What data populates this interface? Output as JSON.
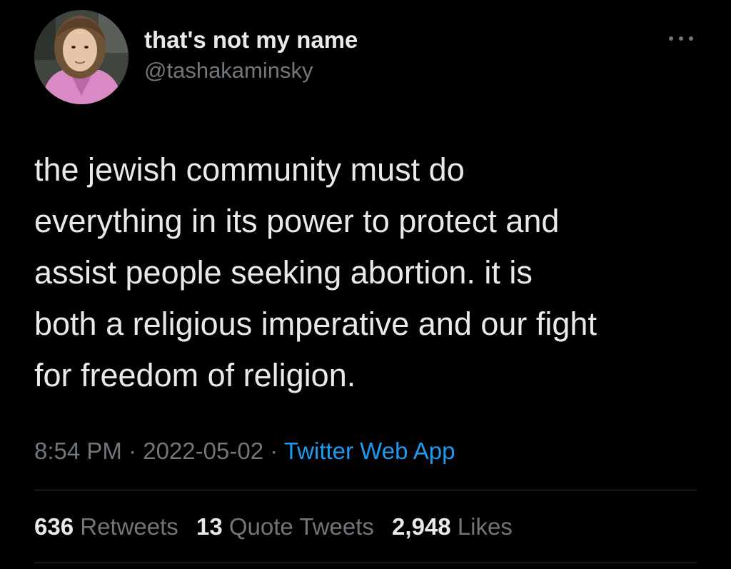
{
  "tweet": {
    "author": {
      "display_name": "that's not my name",
      "handle": "@tashakaminsky"
    },
    "more_icon": "more-horizontal-icon",
    "text": "the jewish community must do\neverything in its power to protect and\nassist people seeking abortion. it is\nboth a religious imperative and our fight\nfor freedom of religion.",
    "time": "8:54 PM",
    "separator": "·",
    "date": "2022-05-02",
    "source": "Twitter Web App",
    "stats": {
      "retweets_count": "636",
      "retweets_label": "Retweets",
      "quotes_count": "13",
      "quotes_label": "Quote Tweets",
      "likes_count": "2,948",
      "likes_label": "Likes"
    }
  },
  "colors": {
    "background": "#000000",
    "primary_text": "#e7e9ea",
    "secondary_text": "#71767b",
    "link": "#1d9bf0",
    "divider": "#2f3336"
  }
}
